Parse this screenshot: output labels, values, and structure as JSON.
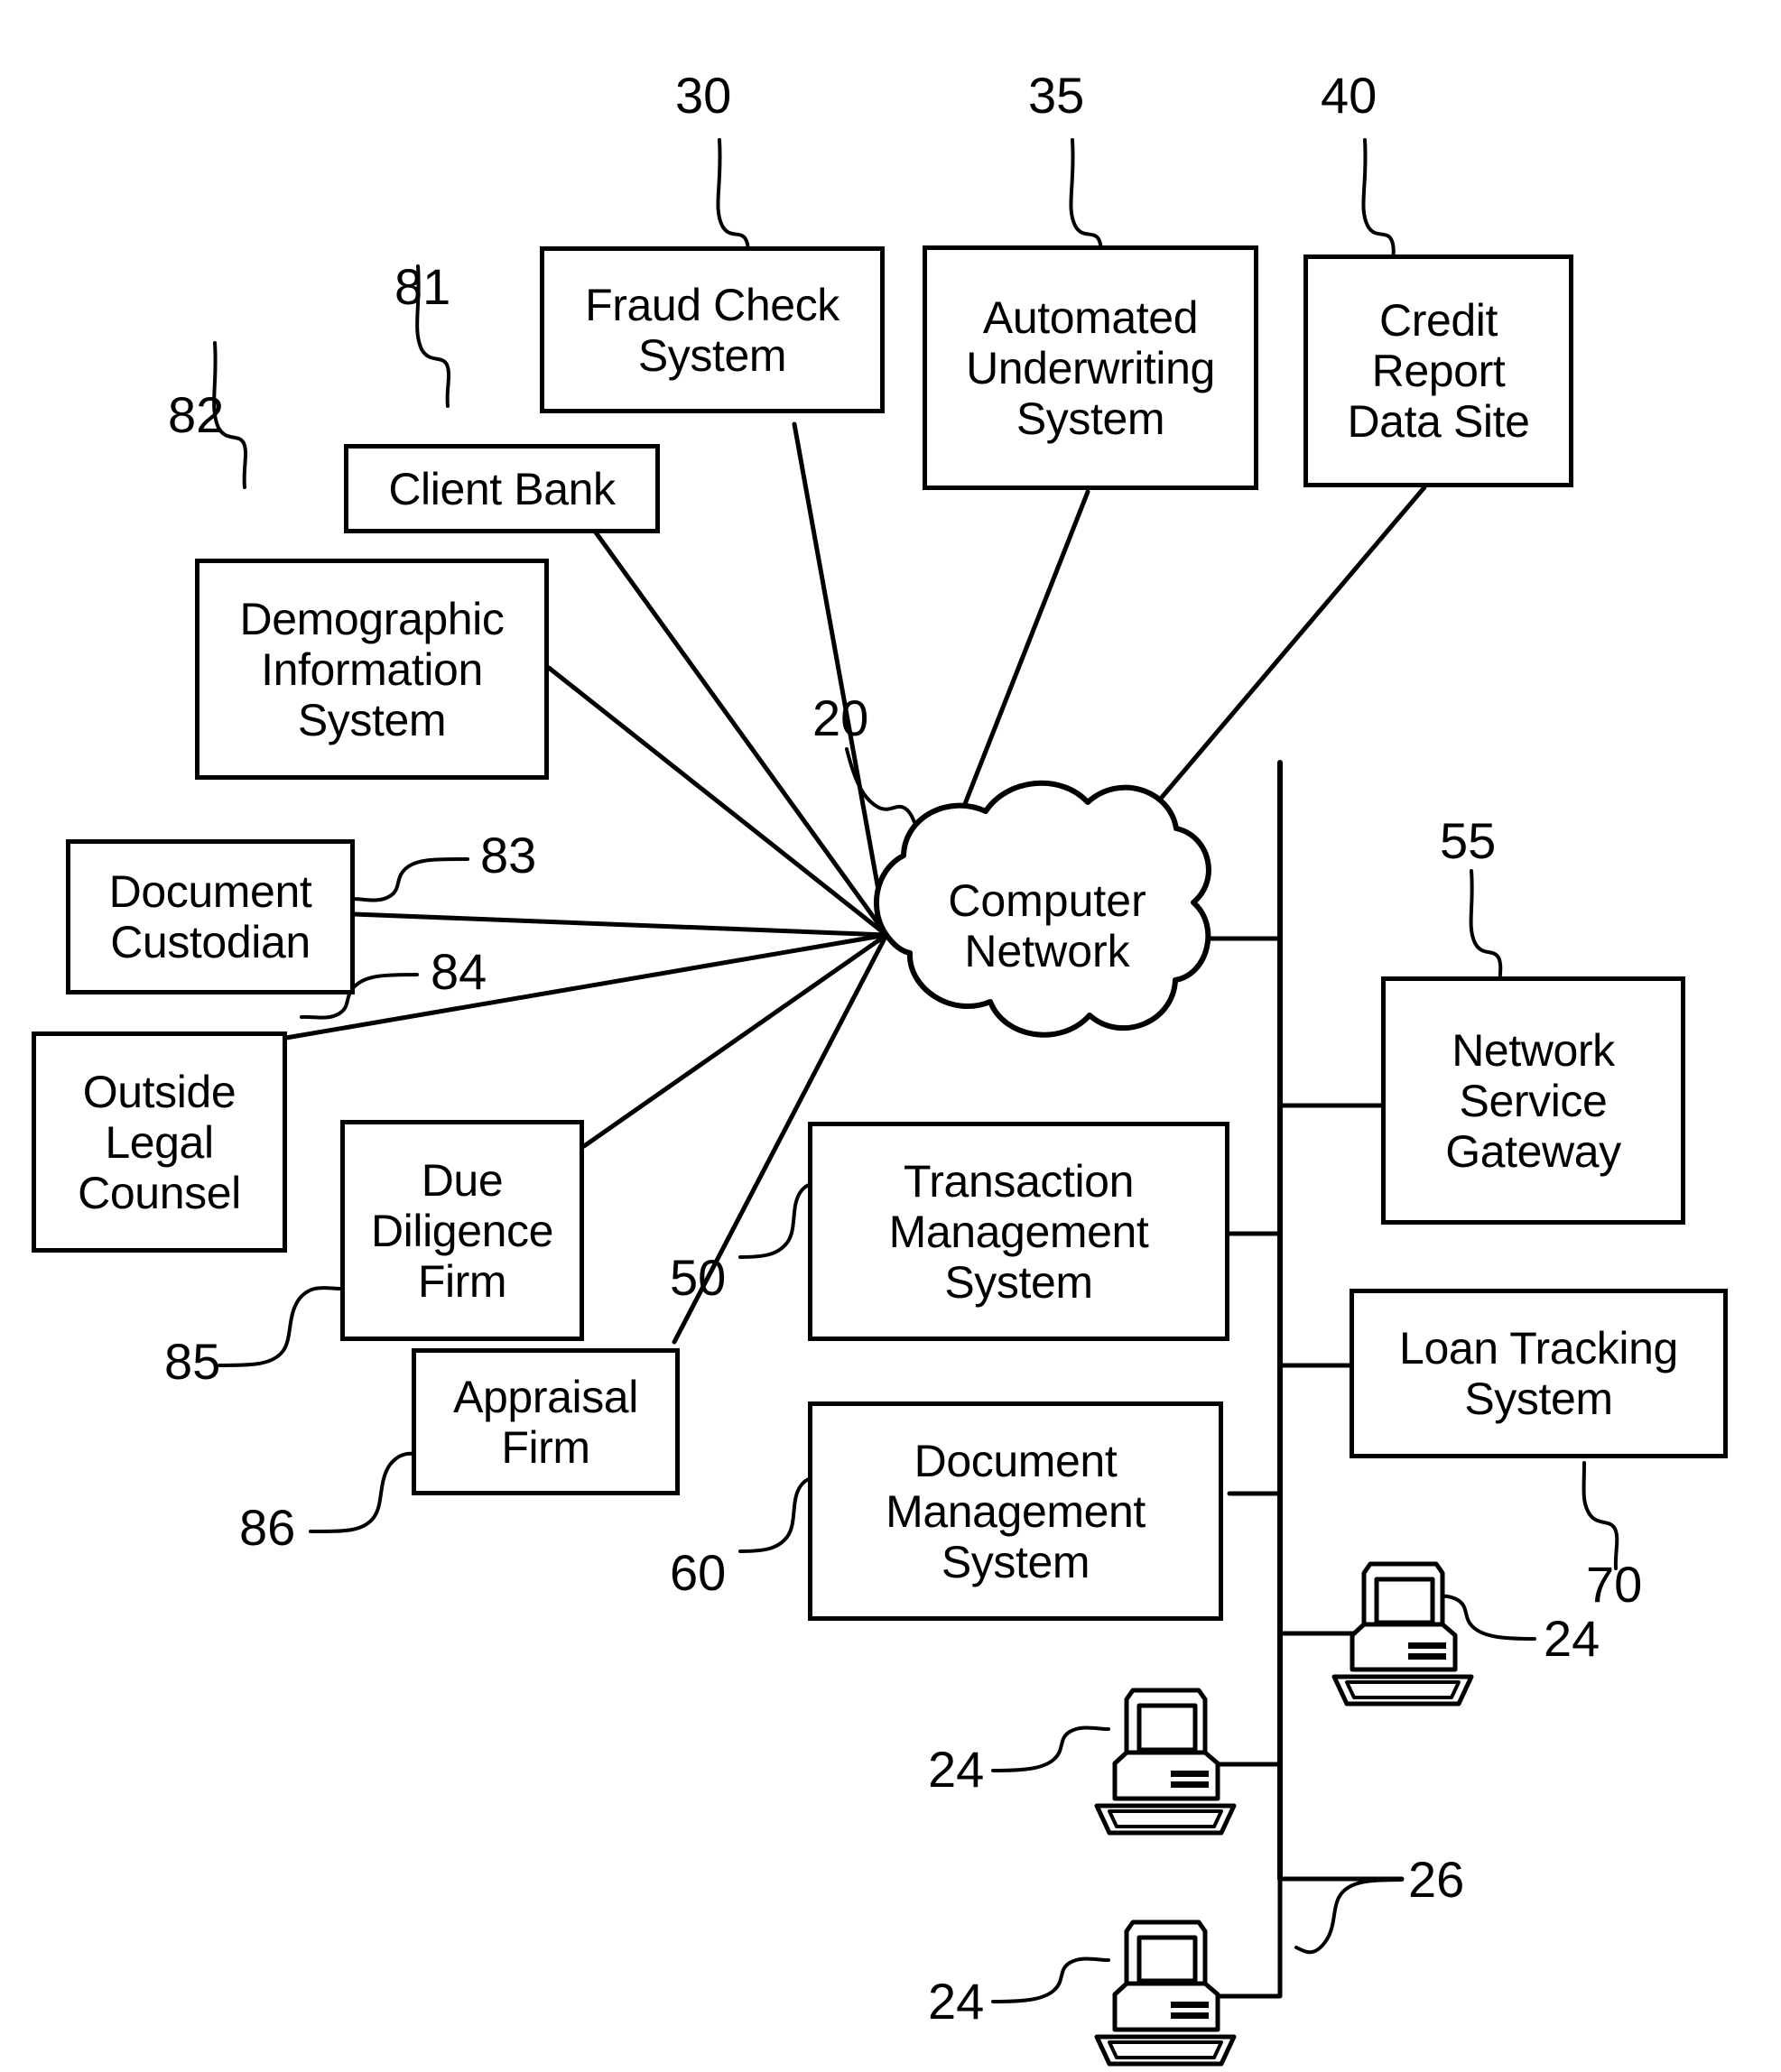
{
  "figure": {
    "title": "Computer network system block diagram",
    "line_color": "#000000",
    "background_color": "#ffffff"
  },
  "nodes": [
    {
      "id": "fraud_check",
      "label": "Fraud Check\nSystem",
      "ref": "30"
    },
    {
      "id": "automated_uw",
      "label": "Automated\nUnderwriting\nSystem",
      "ref": "35"
    },
    {
      "id": "credit_report",
      "label": "Credit\nReport\nData Site",
      "ref": "40"
    },
    {
      "id": "client_bank",
      "label": "Client Bank",
      "ref": "81"
    },
    {
      "id": "demographic_info",
      "label": "Demographic\nInformation\nSystem",
      "ref": "82"
    },
    {
      "id": "document_custodian",
      "label": "Document\nCustodian",
      "ref": "83"
    },
    {
      "id": "outside_legal",
      "label": "Outside\nLegal\nCounsel",
      "ref": "84"
    },
    {
      "id": "due_diligence",
      "label": "Due\nDiligence\nFirm",
      "ref": "85"
    },
    {
      "id": "appraisal_firm",
      "label": "Appraisal\nFirm",
      "ref": "86"
    },
    {
      "id": "computer_network",
      "label": "Computer\nNetwork",
      "ref": "20"
    },
    {
      "id": "transaction_mgmt",
      "label": "Transaction\nManagement\nSystem",
      "ref": "50"
    },
    {
      "id": "document_mgmt",
      "label": "Document\nManagement\nSystem",
      "ref": "60"
    },
    {
      "id": "network_gateway",
      "label": "Network\nService\nGateway",
      "ref": "55"
    },
    {
      "id": "loan_tracking",
      "label": "Loan Tracking\nSystem",
      "ref": "70"
    }
  ],
  "reference_numerals": {
    "n20": "20",
    "n24": "24",
    "n26": "26",
    "n30": "30",
    "n35": "35",
    "n40": "40",
    "n50": "50",
    "n55": "55",
    "n60": "60",
    "n70": "70",
    "n81": "81",
    "n82": "82",
    "n83": "83",
    "n84": "84",
    "n85": "85",
    "n86": "86"
  },
  "workstations": [
    {
      "id": "workstation_top",
      "ref": "24"
    },
    {
      "id": "workstation_middle",
      "ref": "24"
    },
    {
      "id": "workstation_bottom",
      "ref": "24"
    }
  ],
  "bus": {
    "id": "network_bus",
    "ref": "26"
  }
}
